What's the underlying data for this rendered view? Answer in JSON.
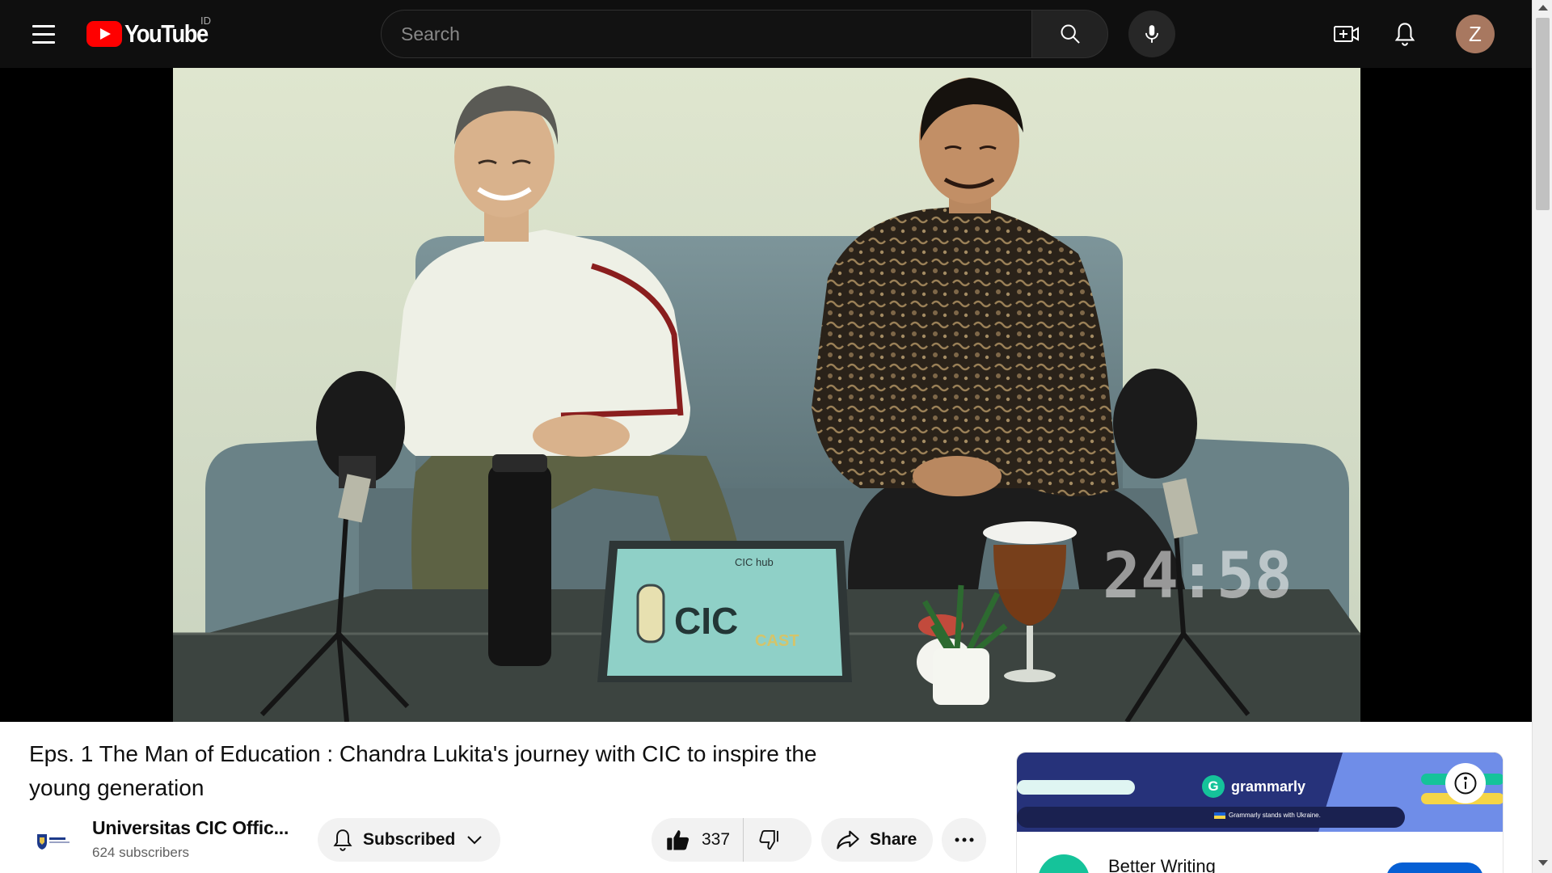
{
  "masthead": {
    "menu_icon": "hamburger-menu-icon",
    "logo_text": "YouTube",
    "country_code": "ID",
    "search_placeholder": "Search",
    "search_icon": "search-icon",
    "mic_icon": "microphone-icon",
    "create_icon": "video-plus-icon",
    "notifications_icon": "bell-icon",
    "avatar_letter": "Z"
  },
  "player": {
    "overlay_timer": "24:58",
    "tablet_brand": "CIC hub",
    "tablet_logo_text": "CIC",
    "tablet_logo_sub": "CAST"
  },
  "video": {
    "title": "Eps. 1 The Man of Education : Chandra Lukita's journey with CIC to inspire the young generation"
  },
  "channel": {
    "name": "Universitas CIC Offic...",
    "subscribers": "624 subscribers",
    "subscribe_label": "Subscribed",
    "subscribe_icon": "bell-icon",
    "subscribe_chevron": "chevron-down-icon"
  },
  "actions": {
    "like_count": "337",
    "like_icon": "thumbs-up-icon",
    "dislike_icon": "thumbs-down-icon",
    "share_label": "Share",
    "share_icon": "share-arrow-icon",
    "more_icon": "more-horizontal-icon"
  },
  "ad": {
    "brand": "grammarly",
    "tagline": "Grammarly stands with Ukraine.",
    "title": "Better Writing",
    "info_icon": "info-icon"
  },
  "colors": {
    "masthead_bg": "#0f0f0f",
    "youtube_red": "#ff0000",
    "pill_bg": "#f2f2f2",
    "ad_navy": "#26327a",
    "grammarly_green": "#15c39a",
    "cta_blue": "#065fd4"
  }
}
